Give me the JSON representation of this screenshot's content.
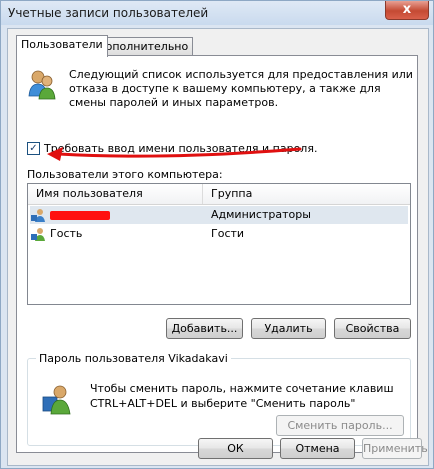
{
  "window": {
    "title": "Учетные записи пользователей",
    "close_label": "x"
  },
  "tabs": [
    {
      "label": "Пользователи"
    },
    {
      "label": "Дополнительно"
    }
  ],
  "description": "Следующий список используется для предоставления или отказа в доступе к вашему компьютеру, а также для смены паролей и иных параметров.",
  "require_password": {
    "label": "Требовать ввод имени пользователя и пароля.",
    "checked": true,
    "check_mark": "✓"
  },
  "users_list": {
    "label": "Пользователи этого компьютера:",
    "columns": [
      "Имя пользователя",
      "Группа"
    ],
    "rows": [
      {
        "name": "",
        "group": "Администраторы",
        "selected": true,
        "redacted": true
      },
      {
        "name": "Гость",
        "group": "Гости",
        "selected": false,
        "redacted": false
      }
    ]
  },
  "buttons": {
    "add": "Добавить...",
    "remove": "Удалить",
    "properties": "Свойства"
  },
  "password_group": {
    "title": "Пароль пользователя Vikadakavi",
    "text": "Чтобы сменить пароль, нажмите сочетание клавиш CTRL+ALT+DEL и выберите \"Сменить пароль\"",
    "change_button": "Сменить пароль..."
  },
  "footer": {
    "ok": "ОК",
    "cancel": "Отмена",
    "apply": "Применить"
  },
  "annotation_color": "#e01010"
}
